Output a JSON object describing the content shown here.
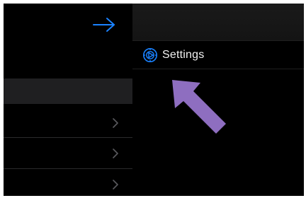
{
  "sidebar": {
    "forward_icon": "arrow-right-icon",
    "rows": [
      {
        "chevron_icon": "chevron-right-icon"
      },
      {
        "chevron_icon": "chevron-right-icon"
      },
      {
        "chevron_icon": "chevron-right-icon"
      }
    ]
  },
  "menu": {
    "settings_label": "Settings",
    "settings_icon": "gear-icon"
  },
  "annotation": {
    "pointer_icon": "pointer-arrow-icon"
  },
  "colors": {
    "background": "#000000",
    "accent_blue": "#1a82ff",
    "annotation_purple": "#8e6ec0",
    "chevron_gray": "#5a5a5e",
    "text": "#f2f2f2"
  }
}
